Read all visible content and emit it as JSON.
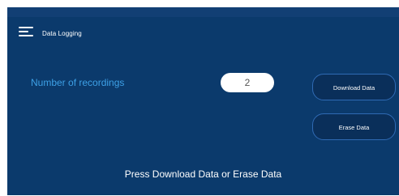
{
  "header": {
    "title": "Data Logging",
    "menu_icon": "hamburger-menu-icon"
  },
  "main": {
    "recordings_label": "Number of recordings",
    "recordings_value": "2",
    "download_button_label": "Download Data",
    "erase_button_label": "Erase Data",
    "status_message": "Press Download Data or Erase Data"
  },
  "colors": {
    "background": "#0b3a6c",
    "accent_text": "#3da0e6",
    "button_border": "#2f6ab4"
  }
}
